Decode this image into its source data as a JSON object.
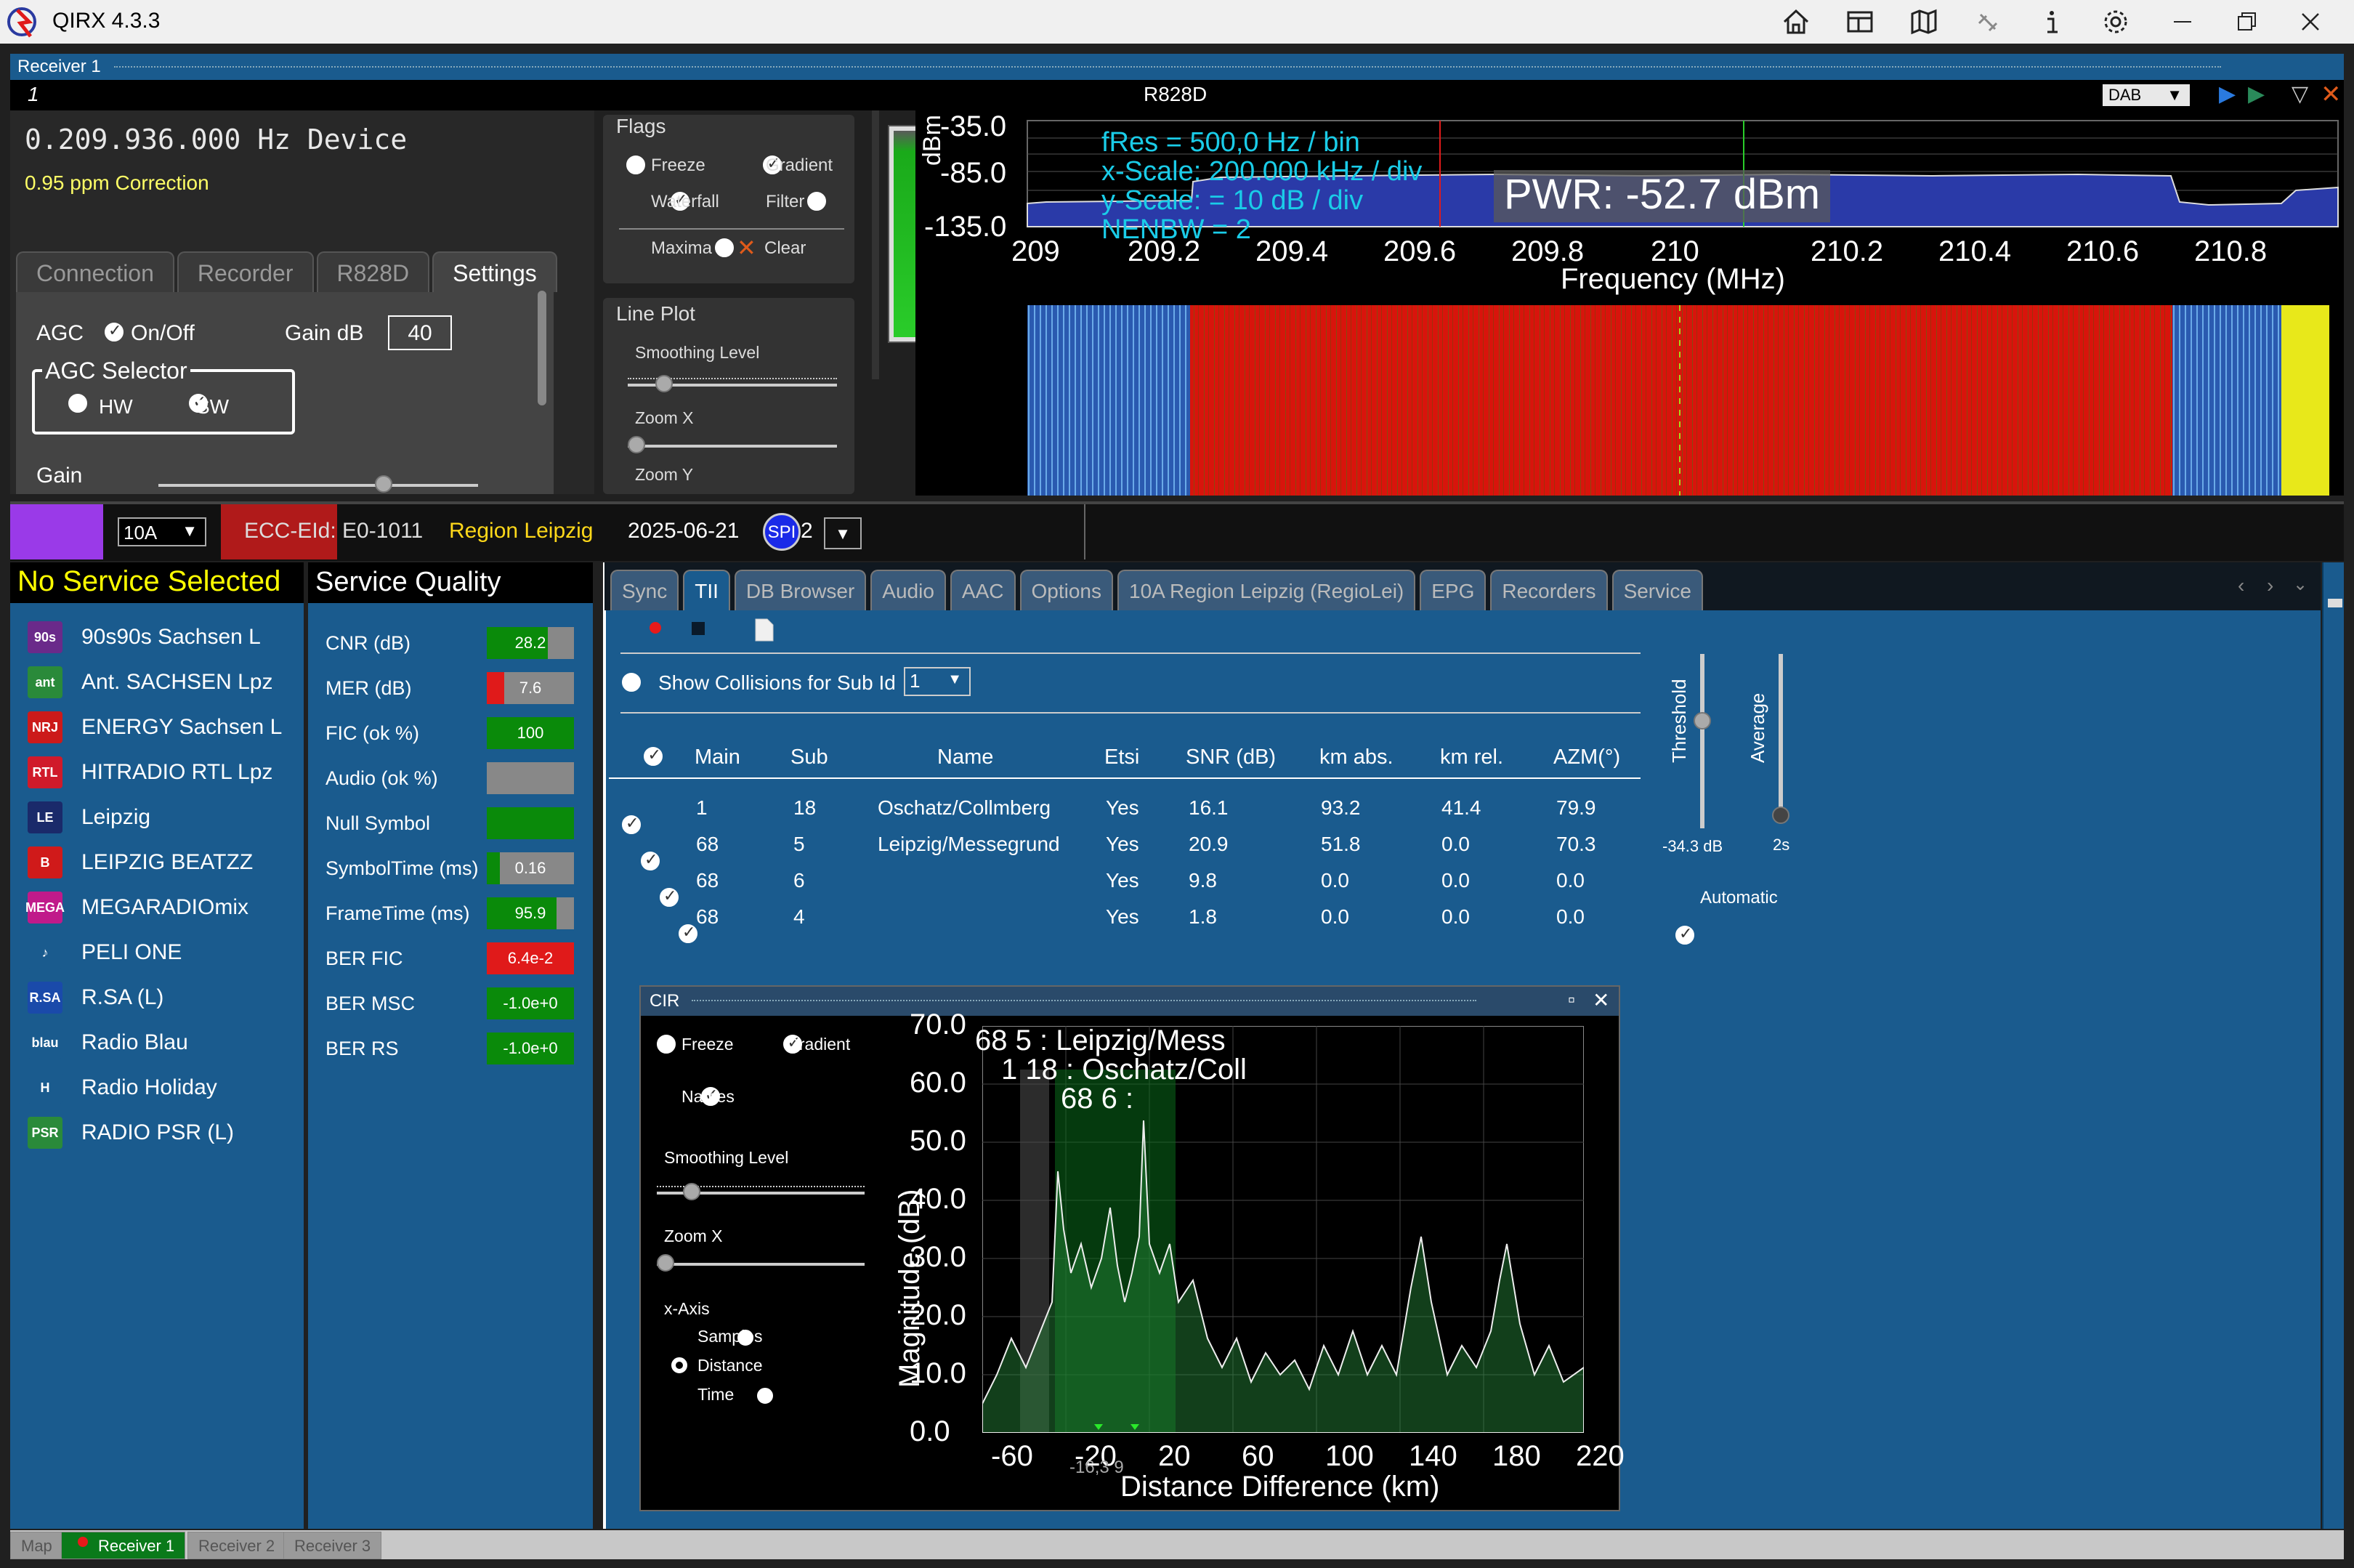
{
  "window": {
    "title": "QIRX 4.3.3"
  },
  "receiver_bar": {
    "label": "Receiver 1"
  },
  "header_row": {
    "left": "1",
    "center": "R828D",
    "mode_select": "DAB"
  },
  "device": {
    "frequency": "0.209.936.000 Hz Device",
    "correction": "0.95 ppm Correction"
  },
  "left_tabs": [
    "Connection",
    "Recorder",
    "R828D",
    "Settings"
  ],
  "settings": {
    "agc": "AGC",
    "agc_onoff": "On/Off",
    "gain_db_label": "Gain dB",
    "gain_db_value": "40",
    "agc_selector": "AGC Selector",
    "hw": "HW",
    "sw": "SW",
    "gain": "Gain"
  },
  "flags": {
    "title": "Flags",
    "freeze": "Freeze",
    "gradient": "Gradient",
    "waterfall": "Waterfall",
    "filter": "Filter",
    "maxima": "Maxima",
    "clear": "Clear"
  },
  "lineplot": {
    "title": "Line Plot",
    "smoothing": "Smoothing Level",
    "zoomx": "Zoom X",
    "zoomy": "Zoom Y"
  },
  "spectrum": {
    "y_ticks": [
      "-35.0",
      "-85.0",
      "-135.0"
    ],
    "ylabel": "dBm",
    "x_ticks": [
      "209",
      "209.2",
      "209.4",
      "209.6",
      "209.8",
      "210",
      "210.2",
      "210.4",
      "210.6",
      "210.8"
    ],
    "xlabel": "Frequency (MHz)",
    "info": [
      "fRes = 500,0 Hz / bin",
      "x-Scale: 200.000 kHz / div",
      "y-Scale: = 10 dB / div",
      "NENBW = 2"
    ],
    "pwr": "PWR: -52.7 dBm"
  },
  "status": {
    "channel": "10A",
    "ecc": "ECC-EId: E0-1011",
    "region": "Region Leipzig",
    "date": "2025-06-21",
    "spi": "SPI",
    "spi_suffix": "2"
  },
  "services": {
    "header": "No Service Selected",
    "items": [
      {
        "name": "90s90s Sachsen L",
        "icon": "90s",
        "color": "#6a2a8a"
      },
      {
        "name": "Ant. SACHSEN Lpz",
        "icon": "ant",
        "color": "#2a8a3a"
      },
      {
        "name": "ENERGY Sachsen L",
        "icon": "NRJ",
        "color": "#cc1a1a"
      },
      {
        "name": "HITRADIO RTL Lpz",
        "icon": "RTL",
        "color": "#d01a2a"
      },
      {
        "name": "Leipzig",
        "icon": "LE",
        "color": "#1a2a6a"
      },
      {
        "name": "LEIPZIG BEATZZ",
        "icon": "B",
        "color": "#d01a1a"
      },
      {
        "name": "MEGARADIOmix",
        "icon": "MEGA",
        "color": "#c01a8a"
      },
      {
        "name": "PELI ONE",
        "icon": "♪",
        "color": "#1a5b8e"
      },
      {
        "name": "R.SA (L)",
        "icon": "R.SA",
        "color": "#1a4aaa"
      },
      {
        "name": "Radio Blau",
        "icon": "blau",
        "color": "#1a5b8e"
      },
      {
        "name": "Radio Holiday",
        "icon": "H",
        "color": "#1a5b8e"
      },
      {
        "name": "RADIO PSR (L)",
        "icon": "PSR",
        "color": "#2a8a3a"
      }
    ]
  },
  "quality": {
    "header": "Service Quality",
    "rows": [
      {
        "label": "CNR (dB)",
        "value": "28.2",
        "fill": 0.7,
        "color": "#0a8a0a"
      },
      {
        "label": "MER (dB)",
        "value": "7.6",
        "fill": 0.2,
        "color": "#e01a1a"
      },
      {
        "label": "FIC (ok %)",
        "value": "100",
        "fill": 1.0,
        "color": "#0a8a0a"
      },
      {
        "label": "Audio (ok %)",
        "value": "",
        "fill": 0.0,
        "color": "#0a8a0a"
      },
      {
        "label": "Null Symbol",
        "value": "",
        "fill": 1.0,
        "color": "#0a8a0a"
      },
      {
        "label": "SymbolTime (ms)",
        "value": "0.16",
        "fill": 0.15,
        "color": "#0a8a0a"
      },
      {
        "label": "FrameTime (ms)",
        "value": "95.9",
        "fill": 0.8,
        "color": "#0a8a0a"
      },
      {
        "label": "BER FIC",
        "value": "6.4e-2",
        "fill": 1.0,
        "color": "#e01a1a"
      },
      {
        "label": "BER MSC",
        "value": "-1.0e+0",
        "fill": 1.0,
        "color": "#0a8a0a"
      },
      {
        "label": "BER RS",
        "value": "-1.0e+0",
        "fill": 1.0,
        "color": "#0a8a0a"
      }
    ]
  },
  "main_tabs": [
    "Sync",
    "TII",
    "DB Browser",
    "Audio",
    "AAC",
    "Options",
    "10A Region Leipzig (RegioLei)",
    "EPG",
    "Recorders",
    "Service"
  ],
  "tii": {
    "show_collisions": "Show Collisions for Sub Id",
    "sub_id": "1",
    "columns": [
      "Main",
      "Sub",
      "Name",
      "Etsi",
      "SNR (dB)",
      "km abs.",
      "km rel.",
      "AZM(°)"
    ],
    "rows": [
      [
        "1",
        "18",
        "Oschatz/Collmberg",
        "Yes",
        "16.1",
        "93.2",
        "41.4",
        "79.9"
      ],
      [
        "68",
        "5",
        "Leipzig/Messegrund",
        "Yes",
        "20.9",
        "51.8",
        "0.0",
        "70.3"
      ],
      [
        "68",
        "6",
        "",
        "Yes",
        "9.8",
        "0.0",
        "0.0",
        "0.0"
      ],
      [
        "68",
        "4",
        "",
        "Yes",
        "1.8",
        "0.0",
        "0.0",
        "0.0"
      ]
    ],
    "threshold_label": "Threshold",
    "threshold_value": "-34.3 dB",
    "average_label": "Average",
    "average_value": "2s",
    "automatic": "Automatic"
  },
  "cir": {
    "title": "CIR",
    "freeze": "Freeze",
    "gradient": "Gradient",
    "names": "Names",
    "smoothing": "Smoothing Level",
    "zoomx": "Zoom X",
    "xaxis": "x-Axis",
    "samples": "Samples",
    "distance": "Distance",
    "time": "Time",
    "y_ticks": [
      "70.0",
      "60.0",
      "50.0",
      "40.0",
      "30.0",
      "20.0",
      "10.0",
      "0.0"
    ],
    "ylabel": "Magnitude (dB)",
    "x_ticks": [
      "-60",
      "-20",
      "20",
      "60",
      "100",
      "140",
      "180",
      "220"
    ],
    "xlabel": "Distance Difference (km)",
    "annotations": [
      "68 5 : Leipzig/Mess",
      "1 18 : Oschatz/Coll",
      "68 6 :"
    ],
    "marker_label": "-16,3 9"
  },
  "bottom_tabs": [
    "Map",
    "Receiver 1",
    "Receiver 2",
    "Receiver 3"
  ]
}
